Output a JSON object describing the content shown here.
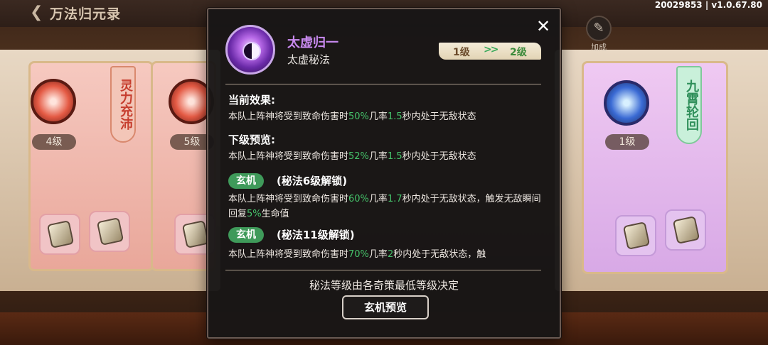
{
  "header": {
    "title": "万法归元录",
    "build": "20029853 | v1.0.67.80"
  },
  "side_button": {
    "label": "加成",
    "icon": "scroll-icon"
  },
  "cards": [
    {
      "banner": "灵力充沛",
      "level": "4级",
      "theme": "red"
    },
    {
      "level": "5级",
      "theme": "red"
    },
    {
      "banner": "九霄轮回",
      "level": "1级",
      "theme": "green"
    }
  ],
  "modal": {
    "skill_name": "太虚归一",
    "skill_type": "太虚秘法",
    "level_from": "1级",
    "level_arrow": ">>",
    "level_to": "2级",
    "current_title": "当前效果:",
    "current_effect": {
      "a": "本队上阵神将受到致命伤害时",
      "v1": "50%",
      "b": "几率",
      "v2": "1.5",
      "c": "秒内处于无敌状态"
    },
    "next_title": "下级预览:",
    "next_effect": {
      "a": "本队上阵神将受到致命伤害时",
      "v1": "52%",
      "b": "几率",
      "v2": "1.5",
      "c": "秒内处于无敌状态"
    },
    "xuanji": [
      {
        "badge": "玄机",
        "unlock": "(秘法6级解锁)",
        "text": {
          "a": "本队上阵神将受到致命伤害时",
          "v1": "60%",
          "b": "几率",
          "v2": "1.7",
          "c": "秒内处于无敌状态，触发无敌瞬间回复",
          "v3": "5%",
          "d": "生命值"
        }
      },
      {
        "badge": "玄机",
        "unlock": "(秘法11级解锁)",
        "text": {
          "a": "本队上阵神将受到致命伤害时",
          "v1": "70%",
          "b": "几率",
          "v2": "2",
          "c": "秒内处于无敌状态，触"
        }
      }
    ],
    "footer_note": "秘法等级由各奇策最低等级决定",
    "preview_button": "玄机预览"
  },
  "colors": {
    "accent_green": "#45c26a",
    "skill_purple": "#c98af0",
    "badge_green": "#3f9a5a"
  }
}
